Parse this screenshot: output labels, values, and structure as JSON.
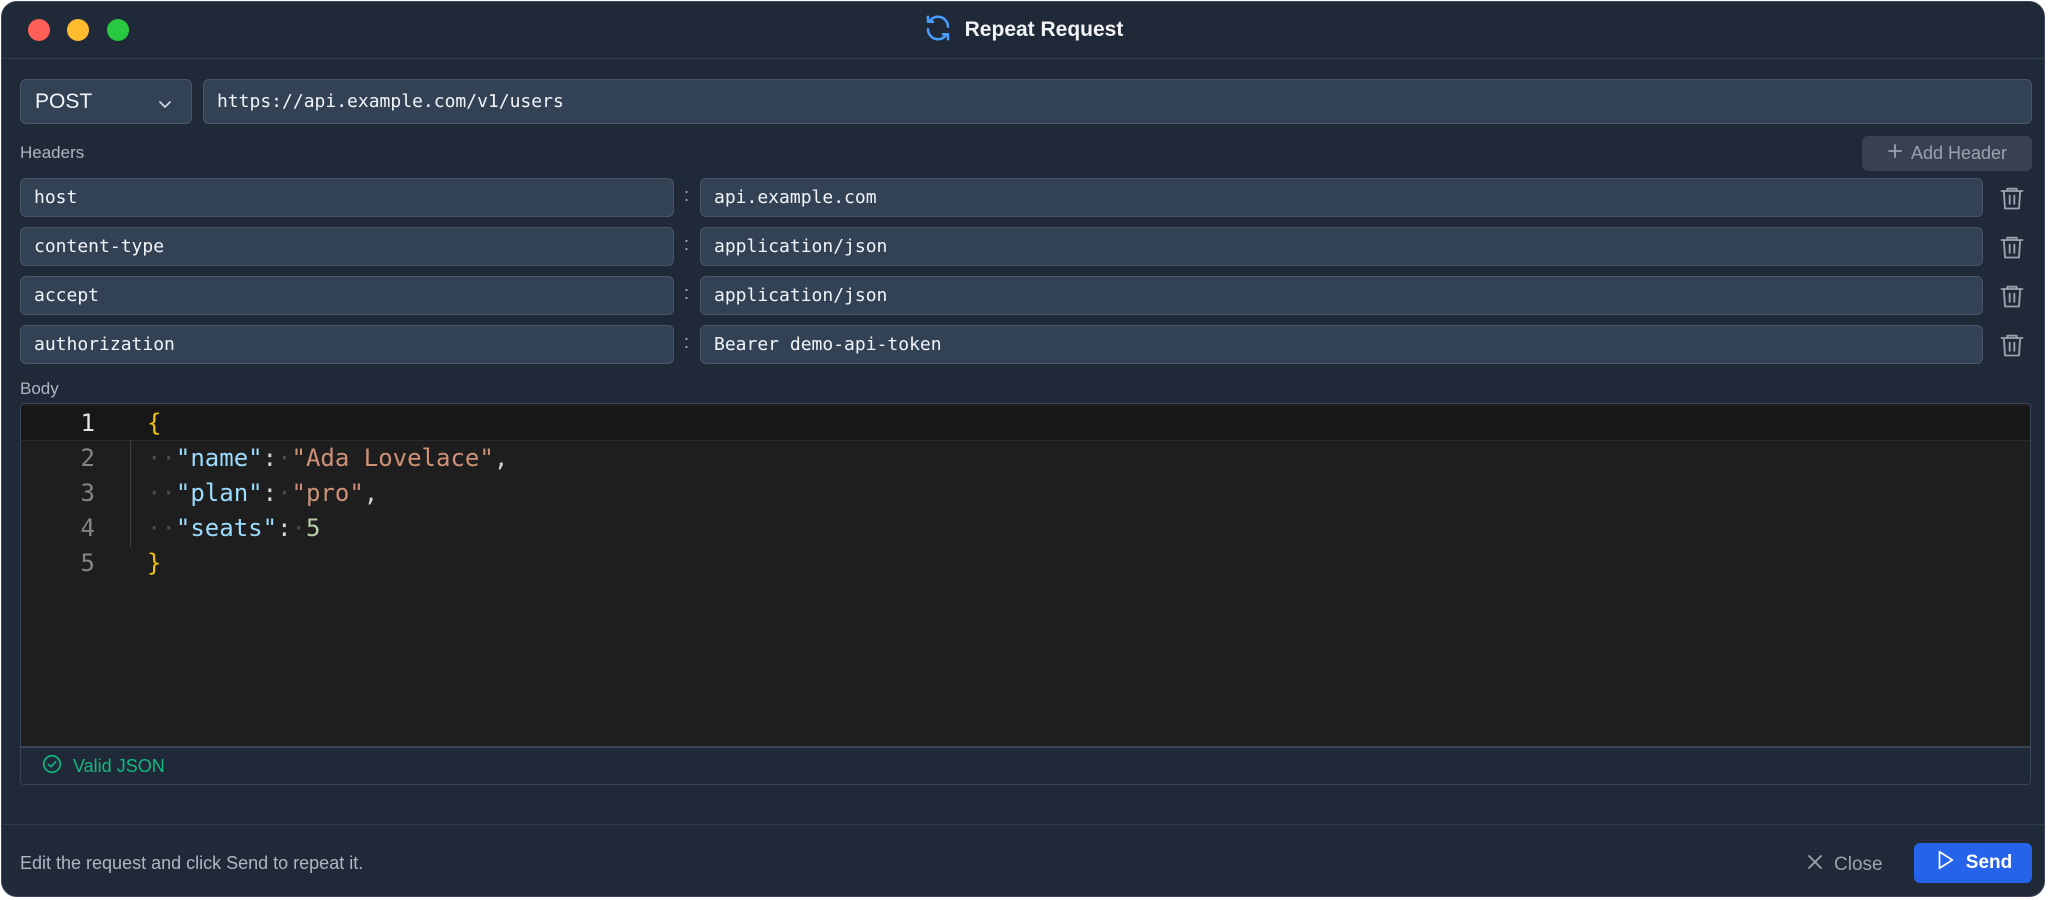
{
  "window": {
    "title": "Repeat Request"
  },
  "request": {
    "method": "POST",
    "url": "https://api.example.com/v1/users"
  },
  "headers_section": {
    "label": "Headers",
    "add_label": "Add Header",
    "separator": ":",
    "rows": [
      {
        "name": "host",
        "value": "api.example.com"
      },
      {
        "name": "content-type",
        "value": "application/json"
      },
      {
        "name": "accept",
        "value": "application/json"
      },
      {
        "name": "authorization",
        "value": "Bearer demo-api-token"
      }
    ]
  },
  "body_section": {
    "label": "Body",
    "line_numbers": [
      "1",
      "2",
      "3",
      "4",
      "5"
    ],
    "code": {
      "open": "{",
      "line2": {
        "key": "\"name\"",
        "colon": ":",
        "value": "\"Ada Lovelace\"",
        "comma": ","
      },
      "line3": {
        "key": "\"plan\"",
        "colon": ":",
        "value": "\"pro\"",
        "comma": ","
      },
      "line4": {
        "key": "\"seats\"",
        "colon": ":",
        "value": "5"
      },
      "close": "}"
    },
    "status": "Valid JSON"
  },
  "footer": {
    "hint": "Edit the request and click Send to repeat it.",
    "close_label": "Close",
    "send_label": "Send"
  },
  "colors": {
    "window_bg": "#1f2937",
    "field_bg": "#334155",
    "editor_bg": "#1e1e1e",
    "accent": "#2563eb",
    "success": "#10b981"
  },
  "icons": [
    "refresh-icon",
    "chevron-down-icon",
    "plus-icon",
    "trash-icon",
    "check-circle-icon",
    "close-icon",
    "play-icon"
  ]
}
